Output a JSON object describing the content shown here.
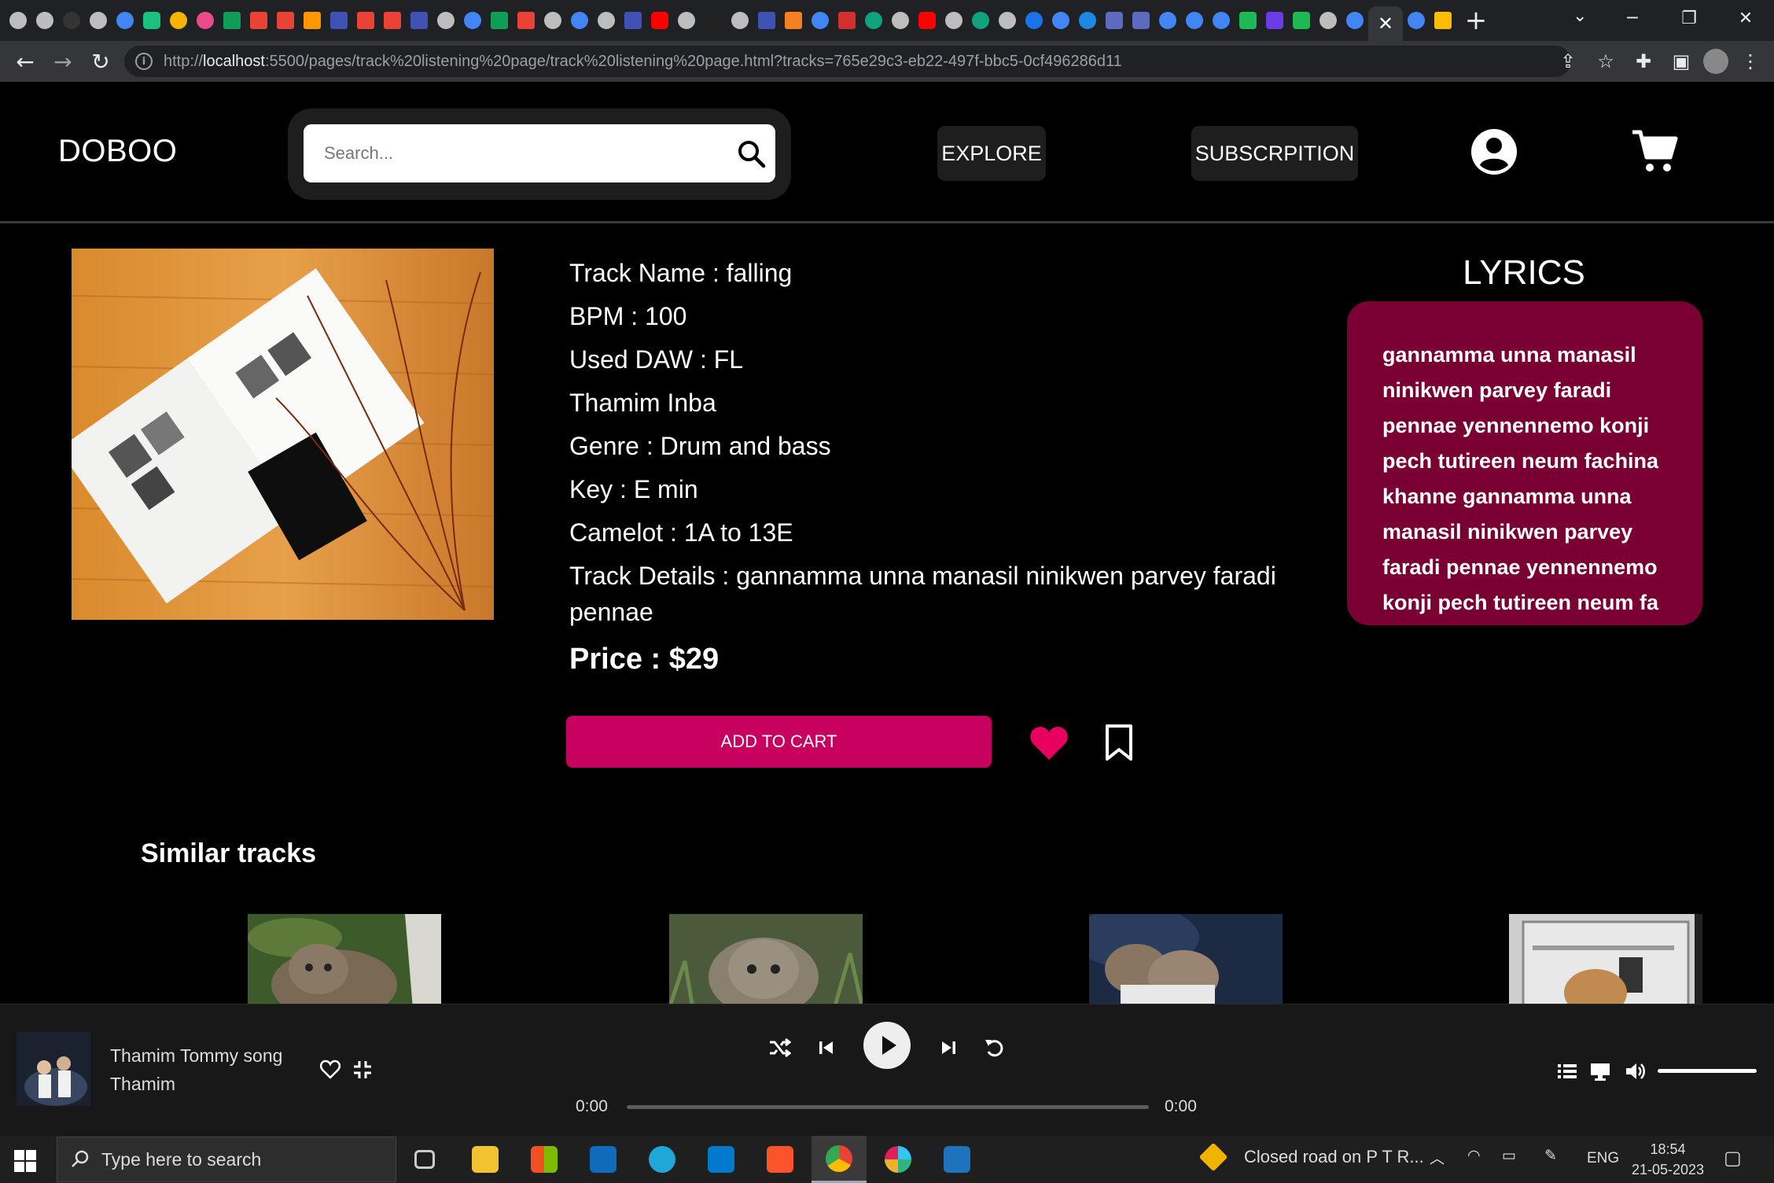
{
  "browser": {
    "url_prefix": "http://",
    "url_host": "localhost",
    "url_rest": ":5500/pages/track%20listening%20page/track%20listening%20page.html?tracks=765e29c3-eb22-497f-bbc5-0cf496286d11",
    "new_tab_glyph": "+",
    "close_tab_glyph": "✕"
  },
  "header": {
    "logo": "DOBOO",
    "search_placeholder": "Search...",
    "explore_label": "EXPLORE",
    "subscription_label": "SUBSCRPITION"
  },
  "track": {
    "name": "Track Name : falling",
    "bpm": "BPM : 100",
    "daw": "Used DAW : FL",
    "artist": "Thamim Inba",
    "genre": "Genre : Drum and bass",
    "key": "Key : E min",
    "camelot": "Camelot : 1A to 13E",
    "details": "Track Details : gannamma unna manasil ninikwen parvey faradi pennae",
    "price": "Price : $29",
    "add_to_cart_label": "ADD TO CART",
    "liked": true
  },
  "lyrics": {
    "title": "LYRICS",
    "text": "gannamma unna manasil ninikwen parvey faradi pennae yennennemo konji pech tutireen neum fachina khanne gannamma unna manasil ninikwen parvey faradi pennae yennennemo konji pech tutireen neum fa"
  },
  "similar": {
    "title": "Similar tracks"
  },
  "player": {
    "song_title": "Thamim Tommy song",
    "song_artist": "Thamim",
    "time_current": "0:00",
    "time_total": "0:00",
    "progress": 0,
    "volume": 1.0
  },
  "taskbar": {
    "search_placeholder": "Type here to search",
    "news": "Closed road on P T R...",
    "language": "ENG",
    "time": "18:54",
    "date": "21-05-2023"
  },
  "colors": {
    "accent": "#c8005f",
    "lyrics_bg": "#7a0033",
    "heart": "#e8005f"
  }
}
